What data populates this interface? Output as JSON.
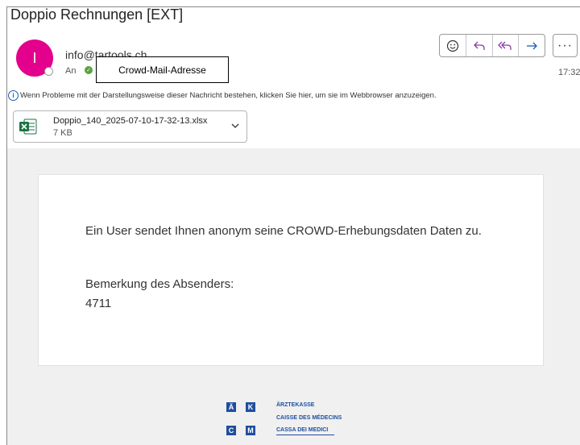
{
  "email": {
    "subject": "Doppio Rechnungen [EXT]",
    "avatar_initial": "I",
    "sender": "info@tartools.ch",
    "to_label": "An",
    "time": "17:32",
    "info_text": "Wenn Probleme mit der Darstellungsweise dieser Nachricht bestehen, klicken Sie hier, um sie im Webbrowser anzuzeigen.",
    "more_label": "···"
  },
  "callout": {
    "text": "Crowd-Mail-Adresse"
  },
  "actions": [
    {
      "name": "emoji",
      "icon": "emoji-icon"
    },
    {
      "name": "reply",
      "icon": "reply-icon"
    },
    {
      "name": "reply-all",
      "icon": "reply-all-icon"
    },
    {
      "name": "forward",
      "icon": "forward-icon"
    }
  ],
  "attachment": {
    "name": "Doppio_140_2025-07-10-17-32-13.xlsx",
    "size": "7 KB",
    "icon": "excel-icon"
  },
  "body": {
    "line1": "Ein User sendet Ihnen anonym seine CROWD-Erhebungsdaten Daten zu.",
    "line2": "Bemerkung des Absenders:",
    "line3": "4711"
  },
  "logo": {
    "letters": [
      "Ä",
      "K",
      "C",
      "M"
    ],
    "line1": "ÄRZTEKASSE",
    "line2": "CAISSE DES MÉDECINS",
    "line3": "CASSA DEI MEDICI"
  },
  "colors": {
    "avatar": "#e3008c",
    "accent": "#1a5fb4",
    "logo_blue": "#1f4e9e",
    "excel_green": "#1e7145"
  }
}
